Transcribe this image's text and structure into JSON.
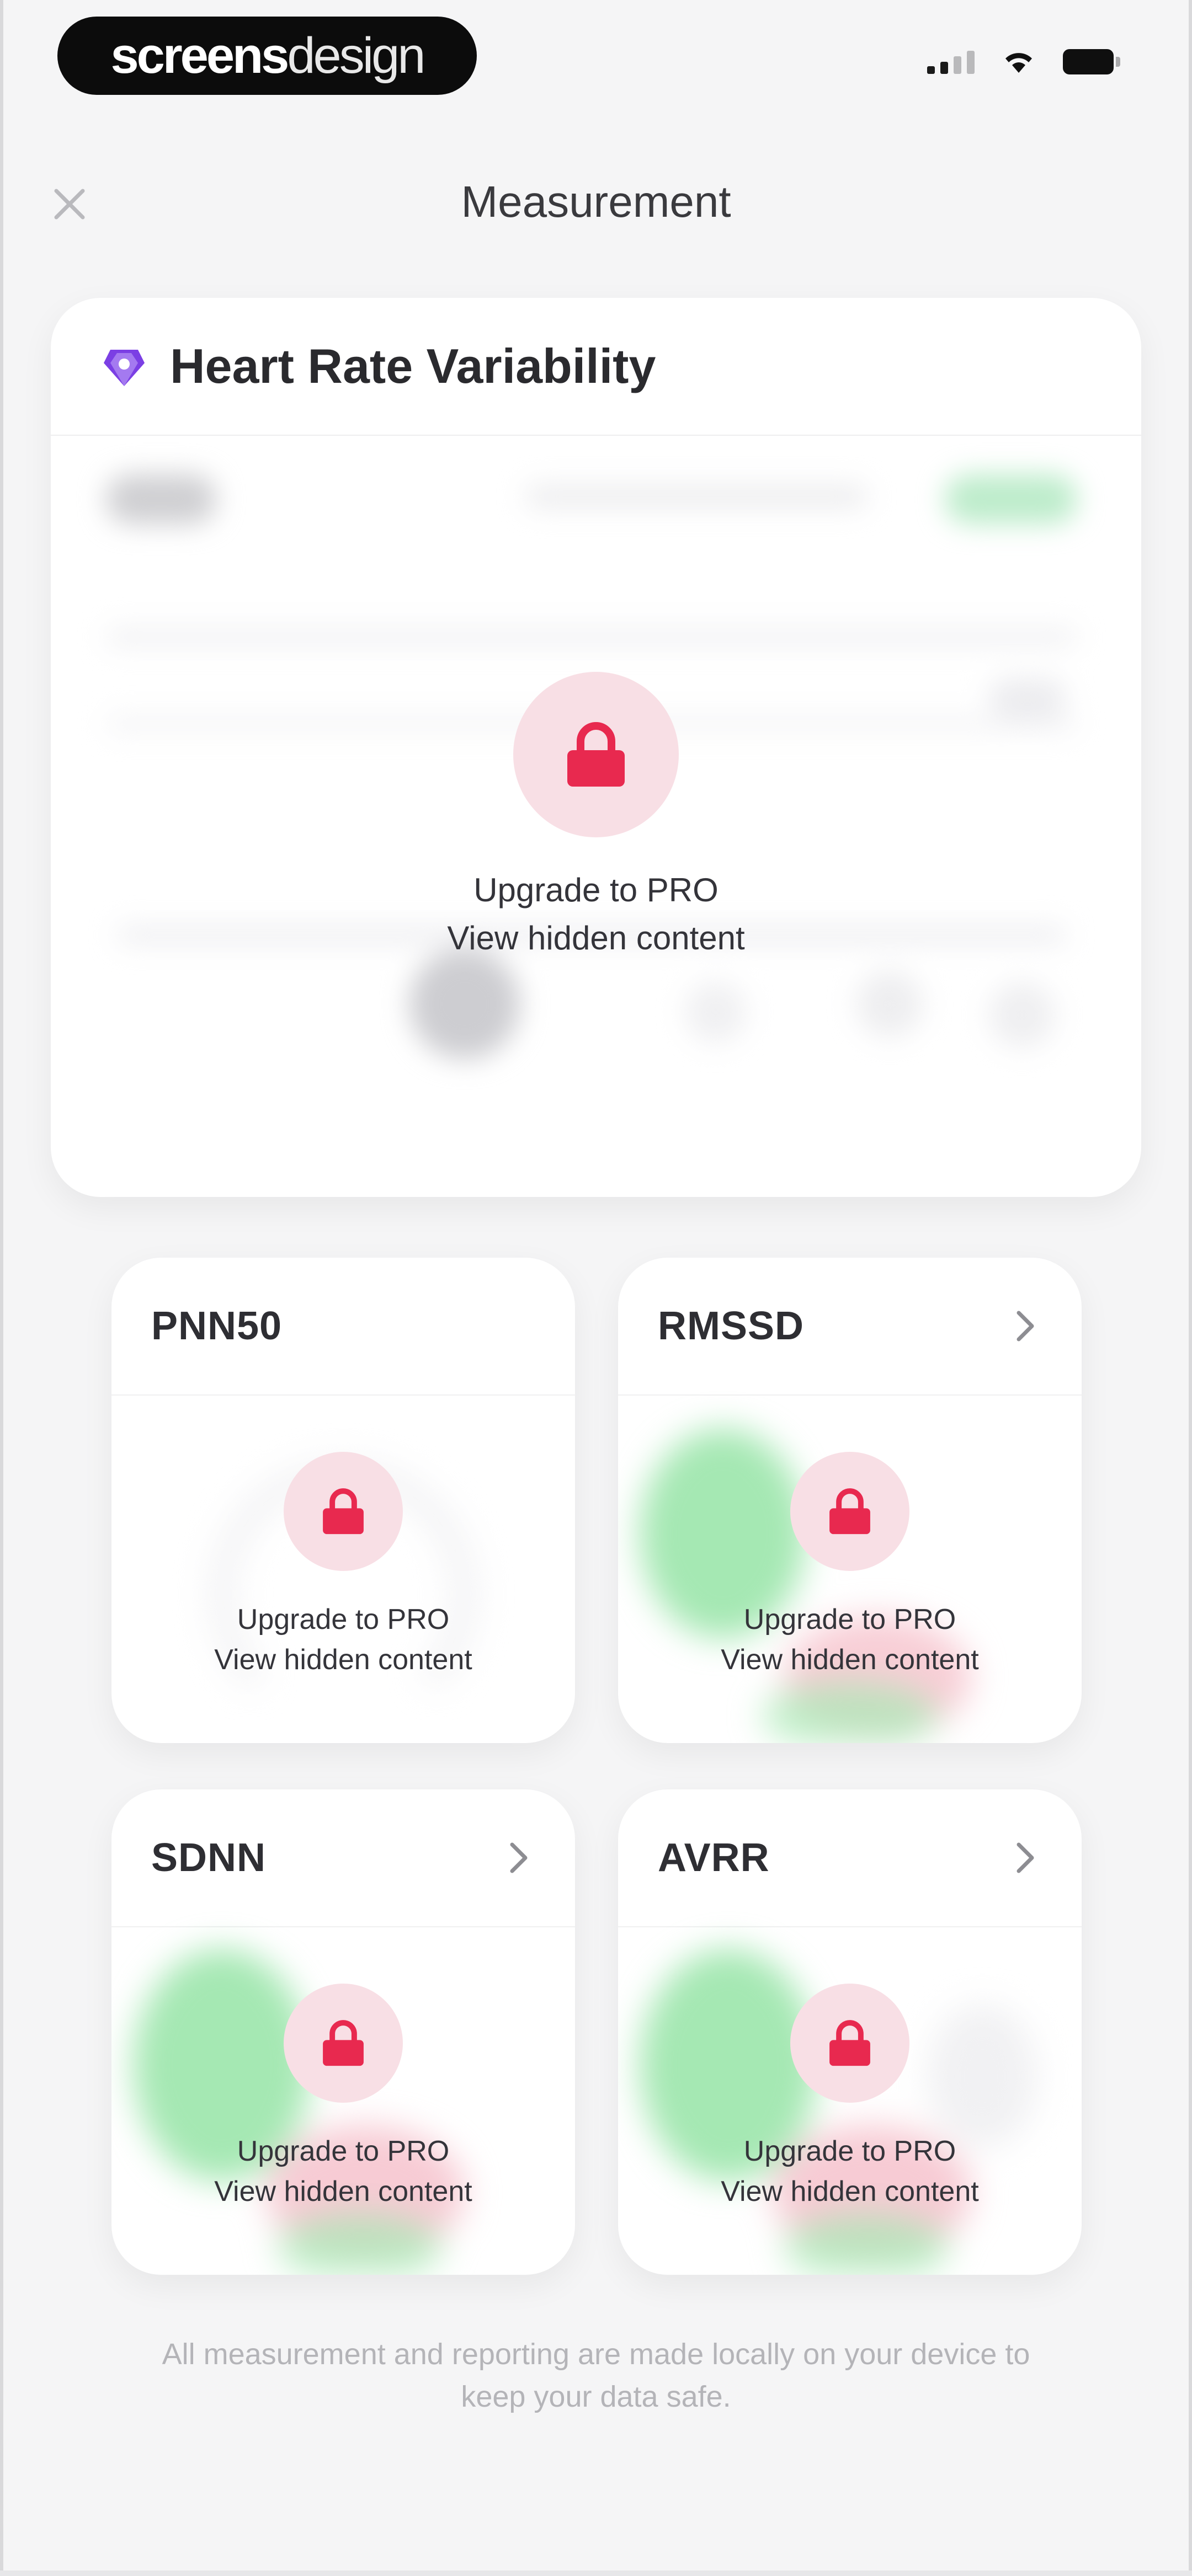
{
  "status_bar": {
    "brand_bold": "screens",
    "brand_light": "design"
  },
  "nav": {
    "title": "Measurement",
    "close_icon": "close-icon"
  },
  "main_card": {
    "title": "Heart Rate Variability",
    "icon": "heart-diamond-icon",
    "accent_color": "#7b3fe4",
    "lock": {
      "line1": "Upgrade to PRO",
      "line2": "View hidden content"
    }
  },
  "metrics": [
    {
      "title": "PNN50",
      "has_chevron": false,
      "line1": "Upgrade to PRO",
      "line2": "View hidden content"
    },
    {
      "title": "RMSSD",
      "has_chevron": true,
      "line1": "Upgrade to PRO",
      "line2": "View hidden content"
    },
    {
      "title": "SDNN",
      "has_chevron": true,
      "line1": "Upgrade to PRO",
      "line2": "View hidden content"
    },
    {
      "title": "AVRR",
      "has_chevron": true,
      "line1": "Upgrade to PRO",
      "line2": "View hidden content"
    }
  ],
  "colors": {
    "lock_red": "#e8294f",
    "lock_bg": "#f8dfe5",
    "gauge_green": "#7fdc8f",
    "gauge_pink": "#f4b3c0"
  },
  "footer": {
    "note": "All measurement and reporting are made locally on your device to keep your data safe."
  }
}
